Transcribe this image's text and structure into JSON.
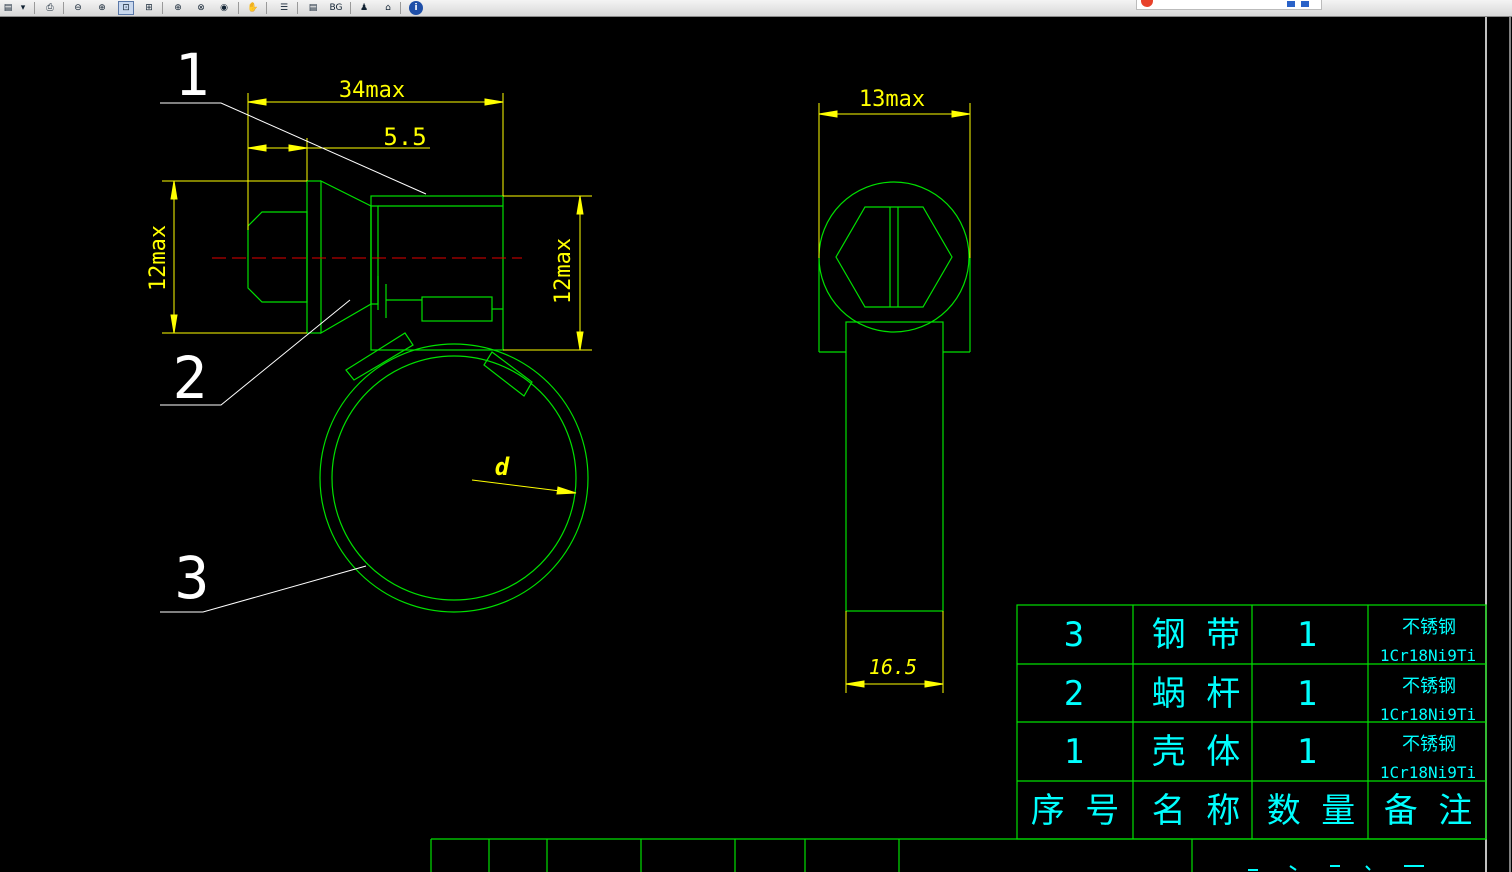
{
  "toolbar": {
    "buttons": [
      {
        "name": "print-icon",
        "glyph": "⎙"
      },
      {
        "name": "zoom-out-icon",
        "glyph": "⊖"
      },
      {
        "name": "zoom-in-icon",
        "glyph": "⊕"
      },
      {
        "name": "zoom-window-icon",
        "glyph": "⊡"
      },
      {
        "name": "zoom-all-icon",
        "glyph": "⊞"
      },
      {
        "name": "zoom-realtime-icon",
        "glyph": "⊕"
      },
      {
        "name": "zoom-previous-icon",
        "glyph": "⊗"
      },
      {
        "name": "view-eye-icon",
        "glyph": "◉"
      },
      {
        "name": "pan-icon",
        "glyph": "✋"
      },
      {
        "name": "layers-icon",
        "glyph": "☰"
      },
      {
        "name": "properties-icon",
        "glyph": "▤"
      },
      {
        "name": "background-icon",
        "glyph": "BG"
      },
      {
        "name": "users-icon",
        "glyph": "♟"
      },
      {
        "name": "home-icon",
        "glyph": "⌂"
      },
      {
        "name": "info-icon",
        "glyph": "i"
      }
    ],
    "bg_label": "BG"
  },
  "drawing": {
    "leaders": [
      "1",
      "2",
      "3"
    ],
    "dims": {
      "length": "34max",
      "offset": "5.5",
      "height_left": "12max",
      "height_right": "12max",
      "width_top": "13max",
      "band_width": "16.5",
      "diameter": "d"
    }
  },
  "bom": {
    "rows": [
      {
        "no": "3",
        "name": "钢  带",
        "qty": "1",
        "mat1": "不锈钢",
        "mat2": "1Cr18Ni9Ti"
      },
      {
        "no": "2",
        "name": "蜗  杆",
        "qty": "1",
        "mat1": "不锈钢",
        "mat2": "1Cr18Ni9Ti"
      },
      {
        "no": "1",
        "name": "壳  体",
        "qty": "1",
        "mat1": "不锈钢",
        "mat2": "1Cr18Ni9Ti"
      }
    ],
    "header": {
      "no": "序  号",
      "name": "名  称",
      "qty": "数  量",
      "note": "备  注"
    }
  },
  "colors": {
    "geometry": "#00e000",
    "dimension": "#ffff00",
    "leader": "#ffffff",
    "table_text": "#00ffff",
    "centerline": "#e00000"
  }
}
